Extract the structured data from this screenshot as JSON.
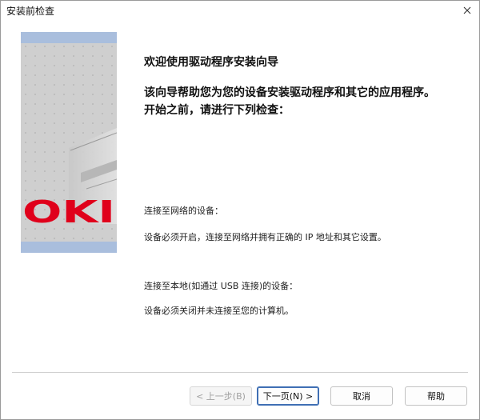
{
  "window": {
    "title": "安装前检查"
  },
  "side_panel": {
    "logo_text": "OKI",
    "colors": {
      "band": "#a9bedd",
      "logo": "#e0001b",
      "panel": "#cfcfcf"
    }
  },
  "content": {
    "welcome": "欢迎使用驱动程序安装向导",
    "description_line1": "该向导帮助您为您的设备安装驱动程序和其它的应用程序。",
    "description_line2": "开始之前，请进行下列检查：",
    "network": {
      "title": "连接至网络的设备：",
      "desc": "设备必须开启，连接至网络并拥有正确的 IP 地址和其它设置。"
    },
    "usb": {
      "title": "连接至本地(如通过 USB 连接)的设备：",
      "desc": "设备必须关闭并未连接至您的计算机。"
    }
  },
  "buttons": {
    "back": "< 上一步(B)",
    "next": "下一页(N) >",
    "cancel": "取消",
    "help": "帮助"
  },
  "icons": {
    "close": "close-icon"
  }
}
